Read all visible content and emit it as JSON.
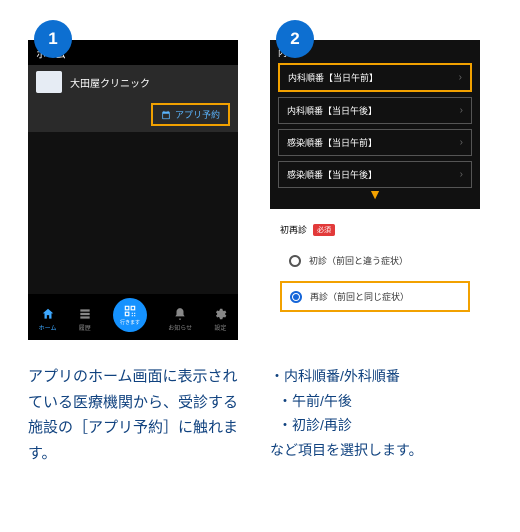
{
  "step1": {
    "badge": "1",
    "header": "ホーム",
    "clinic_name": "大田屋クリニック",
    "app_btn": "アプリ予約",
    "nav": {
      "home": "ホーム",
      "history": "履歴",
      "center": "行きます",
      "notice": "お知らせ",
      "settings": "設定"
    },
    "caption": "アプリのホーム画面に表示されている医療機関から、受診する施設の［アプリ予約］に触れます。"
  },
  "step2": {
    "badge": "2",
    "department": "内科",
    "slots": [
      "内科順番【当日午前】",
      "内科順番【当日午後】",
      "感染順番【当日午前】",
      "感染順番【当日午後】"
    ],
    "section_label": "初再診",
    "required": "必須",
    "radios": [
      "初診（前回と違う症状）",
      "再診（前回と同じ症状）"
    ],
    "caption_lines": [
      "・内科順番/外科順番",
      "・午前/午後",
      "・初診/再診",
      "など項目を選択します。"
    ]
  }
}
